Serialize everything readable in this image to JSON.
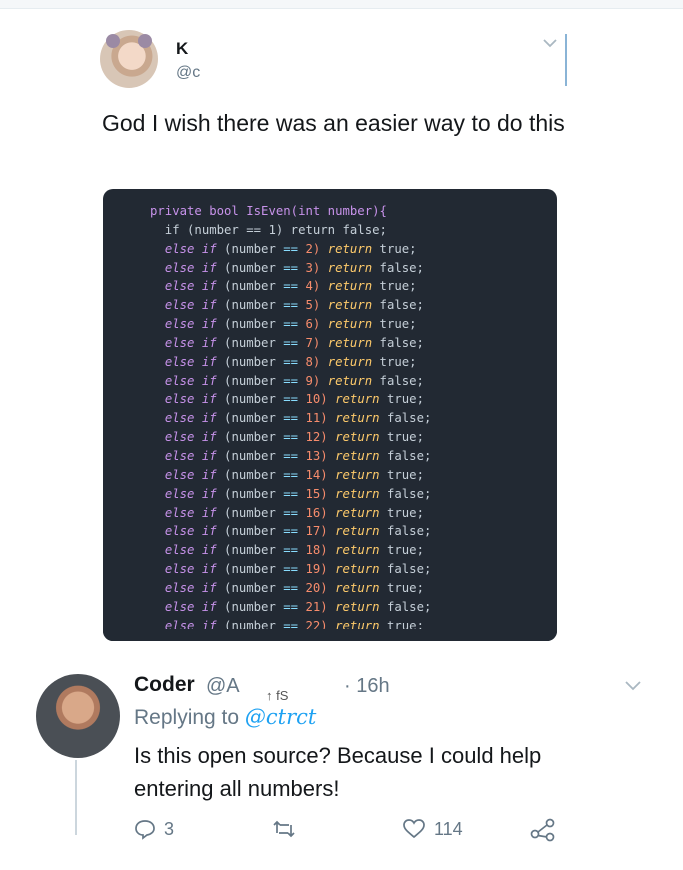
{
  "tweet": {
    "author_name": "K",
    "author_handle": "@c",
    "text": "God I wish there was an easier way to do this"
  },
  "code_image": {
    "header": "private bool IsEven(int number){",
    "first_line": "if (number == 1) return false;",
    "lines": [
      {
        "n": "2",
        "ret": "true;"
      },
      {
        "n": "3",
        "ret": "false;"
      },
      {
        "n": "4",
        "ret": "true;"
      },
      {
        "n": "5",
        "ret": "false;"
      },
      {
        "n": "6",
        "ret": "true;"
      },
      {
        "n": "7",
        "ret": "false;"
      },
      {
        "n": "8",
        "ret": "true;"
      },
      {
        "n": "9",
        "ret": "false;"
      },
      {
        "n": "10",
        "ret": "true;"
      },
      {
        "n": "11",
        "ret": "false;"
      },
      {
        "n": "12",
        "ret": "true;"
      },
      {
        "n": "13",
        "ret": "false;"
      },
      {
        "n": "14",
        "ret": "true;"
      },
      {
        "n": "15",
        "ret": "false;"
      },
      {
        "n": "16",
        "ret": "true;"
      },
      {
        "n": "17",
        "ret": "false;"
      },
      {
        "n": "18",
        "ret": "true;"
      },
      {
        "n": "19",
        "ret": "false;"
      },
      {
        "n": "20",
        "ret": "true;"
      },
      {
        "n": "21",
        "ret": "false;"
      },
      {
        "n": "22",
        "ret": "true;"
      }
    ]
  },
  "reply": {
    "author_name": "Coder",
    "author_handle": "@A",
    "time": "· 16h",
    "replying_prefix": "Replying to",
    "replying_handle": "@ctrct",
    "scribble": "↑ fS",
    "text": "Is this open source? Because I could help entering all numbers!"
  },
  "actions": {
    "reply_count": "3",
    "retweet_count": "",
    "like_count": "114"
  },
  "colors": {
    "accent": "#1da1f2",
    "muted": "#657786",
    "code_bg": "#222933"
  }
}
